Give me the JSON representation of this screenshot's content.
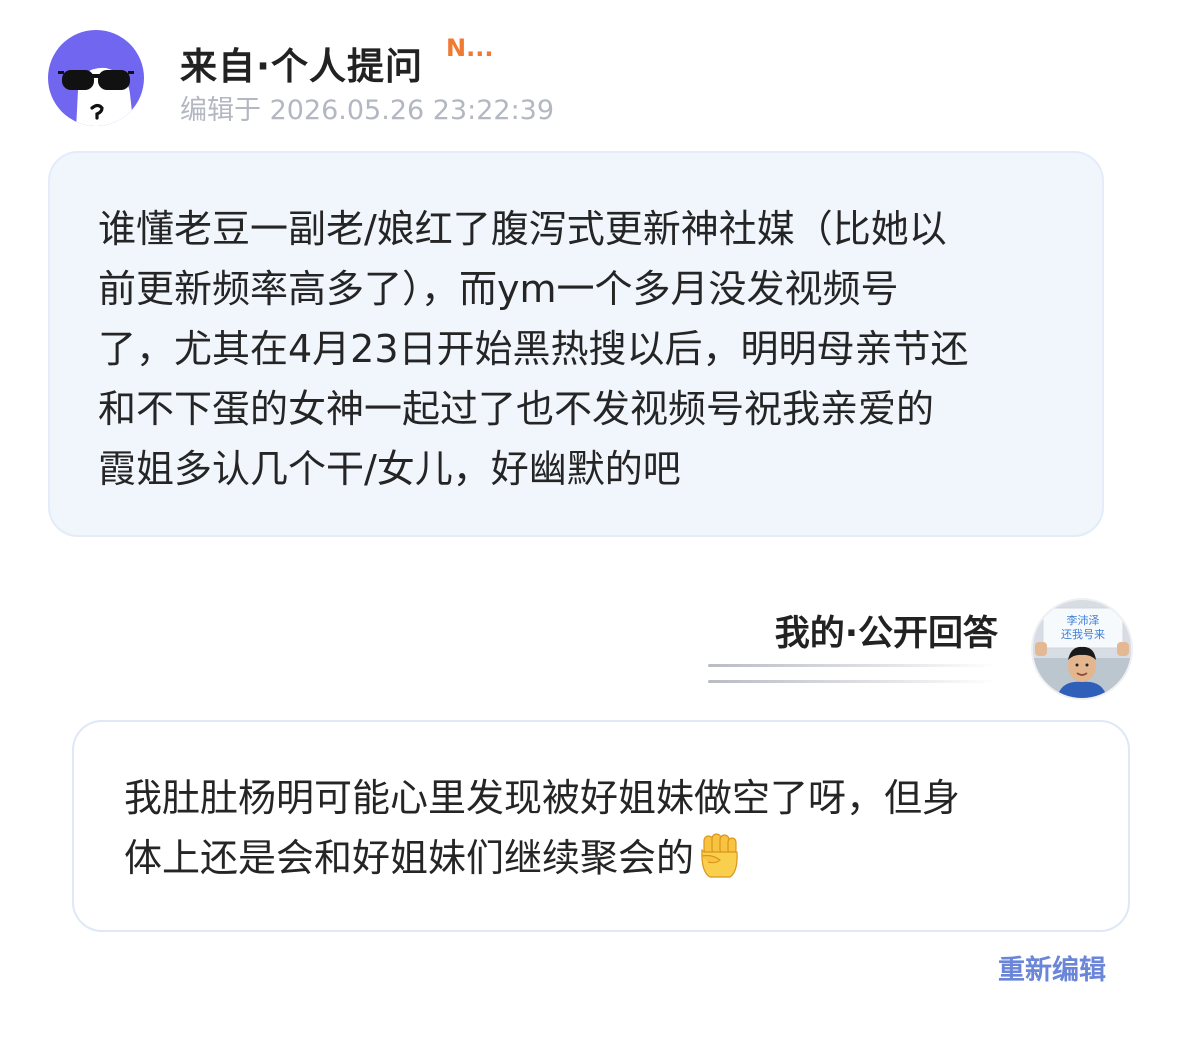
{
  "question": {
    "header": {
      "title": "来自·个人提问",
      "tag": "N...",
      "edit_time": "编辑于 2026.05.26 23:22:39"
    },
    "avatar_icon": "sunglasses-face-icon",
    "text": "谁懂老豆一副老/娘红了腹泻式更新神社媒（比她以\n前更新频率高多了），而ym一个多月没发视频号\n了，尤其在4月23日开始黑热搜以后，明明母亲节还\n和不下蛋的女神一起过了也不发视频号祝我亲爱的\n霞姐多认几个干/女儿，好幽默的吧"
  },
  "answer": {
    "label": "我的·公开回答",
    "avatar": {
      "sign_line1": "李沛泽",
      "sign_line2": "还我号来"
    },
    "text": "我肚肚杨明可能心里发现被好姐妹做空了呀，但身\n体上还是会和好姐妹们继续聚会的",
    "emoji_icon": "raised-fist-emoji-icon",
    "reedit_label": "重新编辑"
  },
  "colors": {
    "asker_avatar_bg": "#7066ef",
    "tag_orange": "#f07a32",
    "question_bubble_bg": "#f1f6fd",
    "link_blue": "#6b86d8"
  }
}
